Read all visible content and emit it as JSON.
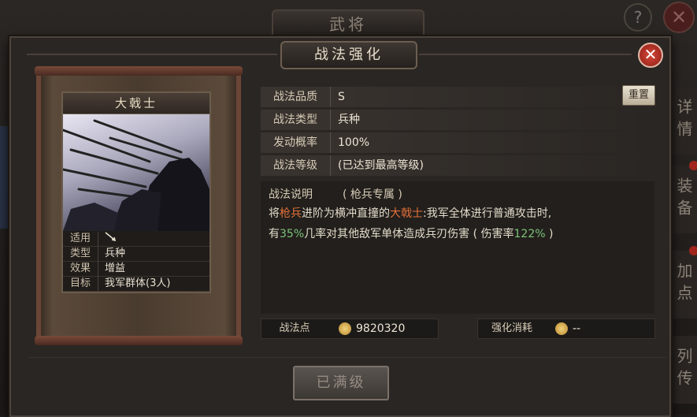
{
  "background": {
    "window_title": "武将",
    "help_glyph": "?",
    "close_glyph": "✕",
    "side_tabs": [
      "详情",
      "装备",
      "加点",
      "列传"
    ]
  },
  "dialog": {
    "title": "战法强化",
    "close_glyph": "✕",
    "card": {
      "name": "大戟士",
      "stats": [
        {
          "label": "适用",
          "value": ""
        },
        {
          "label": "类型",
          "value": "兵种"
        },
        {
          "label": "效果",
          "value": "增益"
        },
        {
          "label": "目标",
          "value": "我军群体(3人)"
        }
      ],
      "applicable_icon": "halberd-icon"
    },
    "info": {
      "quality_label": "战法品质",
      "quality_value": "S",
      "type_label": "战法类型",
      "type_value": "兵种",
      "rate_label": "发动概率",
      "rate_value": "100%",
      "level_label": "战法等级",
      "level_value": "(已达到最高等级)"
    },
    "reset_button": "重置",
    "description": {
      "label": "战法说明",
      "tag": "( 枪兵专属 )",
      "line1_a": "将",
      "line1_b": "枪兵",
      "line1_c": "进阶为横冲直撞的",
      "line1_d": "大戟士",
      "line1_e": ":我军全体进行普通攻击时,",
      "line2_a": "有",
      "line2_b": "35%",
      "line2_c": "几率对其他敌军单体造成兵刃伤害 ( 伤害率",
      "line2_d": "122%",
      "line2_e": " )"
    },
    "points": {
      "label": "战法点",
      "value": "9820320",
      "cost_label": "强化消耗",
      "cost_value": "--"
    },
    "max_button": "已满级"
  },
  "colors": {
    "highlight_red": "#e2703a",
    "highlight_green": "#7cc47a",
    "close_red": "#c0342a"
  }
}
